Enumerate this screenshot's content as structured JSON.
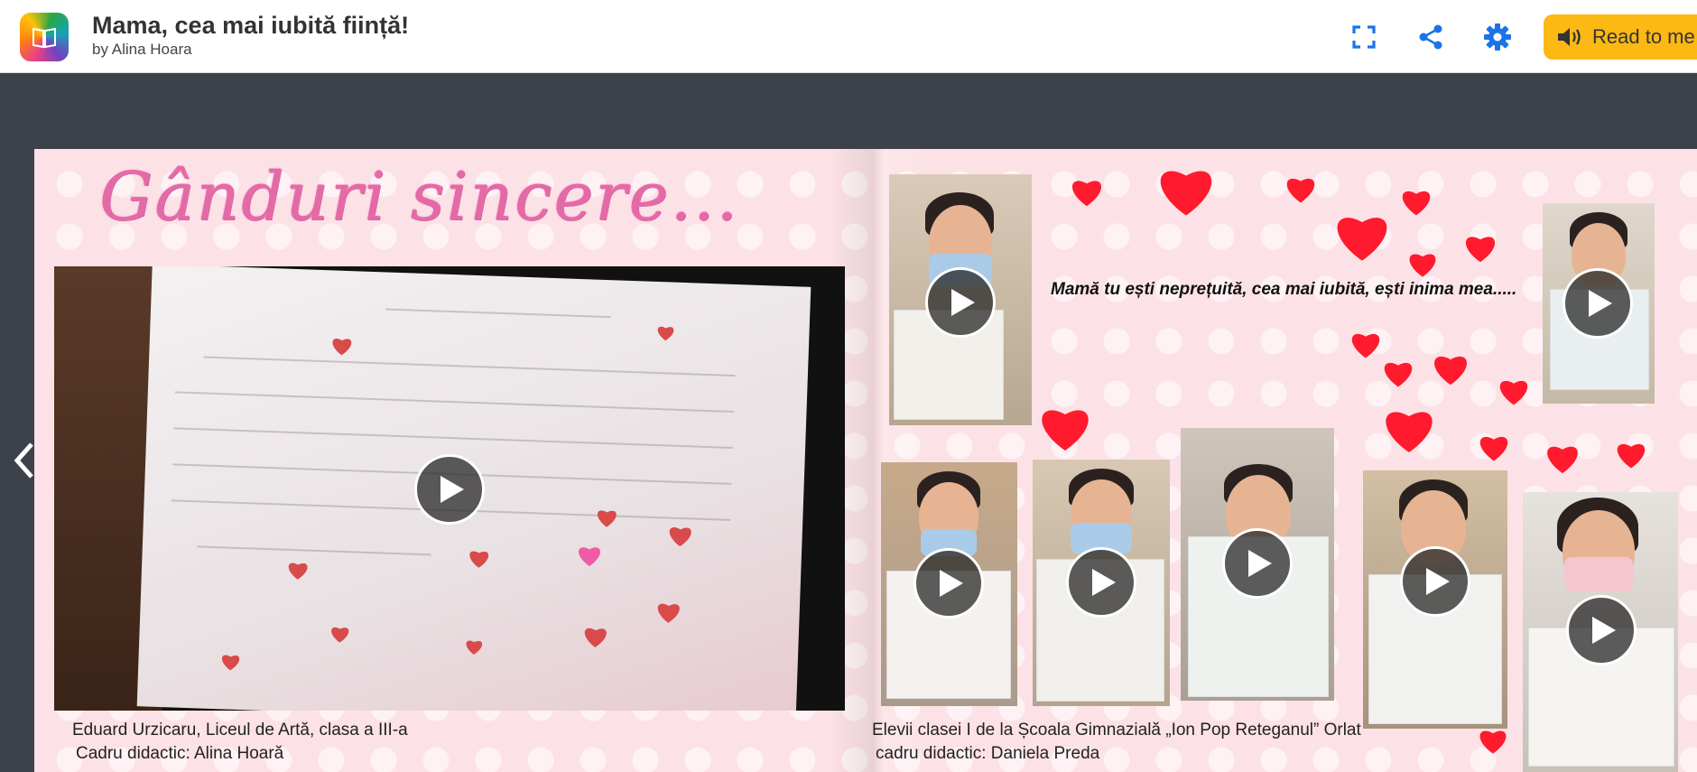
{
  "header": {
    "title": "Mama, cea mai iubită ființă!",
    "byline": "by Alina Hoara",
    "read_label": "Read to me",
    "icons": [
      "fullscreen-icon",
      "share-icon",
      "settings-icon",
      "speaker-icon"
    ]
  },
  "left_page": {
    "title": "Gânduri sincere...",
    "caption_line1": "Eduard Urzicaru, Liceul de Artă, clasa a III-a",
    "caption_line2": "Cadru didactic: Alina Hoară"
  },
  "right_page": {
    "quote": "Mamă tu ești neprețuită, cea mai iubită, ești inima mea.....",
    "caption_line1": "Elevii clasei I de la Școala Gimnazială „Ion Pop Reteganul” Orlat",
    "caption_line2": "cadru didactic: Daniela Preda"
  },
  "colors": {
    "header_bg": "#ffffff",
    "app_bg": "#3c414a",
    "page_pink": "#fce2e6",
    "accent_blue": "#1a73e8",
    "read_button": "#fcb813",
    "heart_red": "#ff1a2e",
    "title_pink": "#e46aa7"
  }
}
